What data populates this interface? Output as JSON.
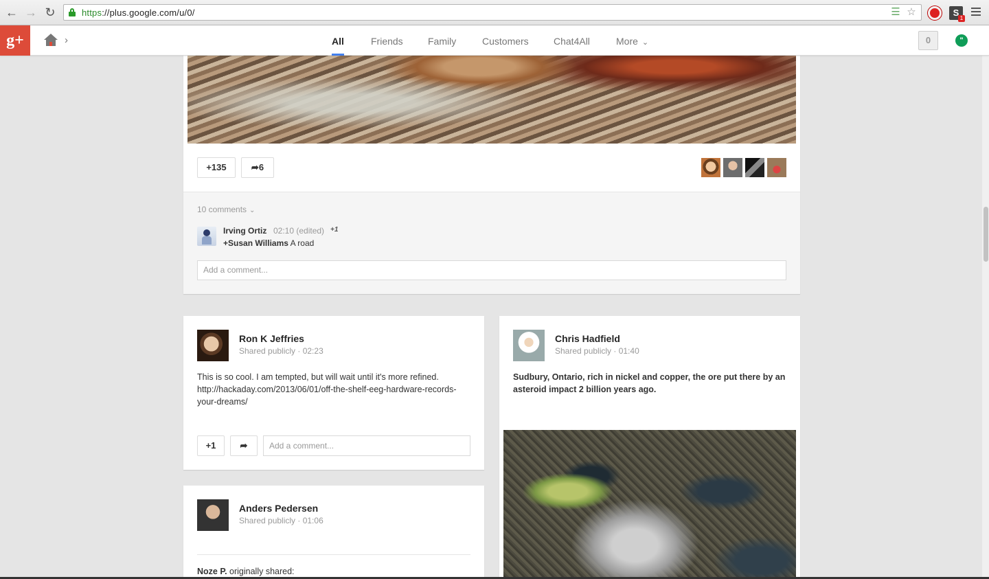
{
  "browser": {
    "url_scheme": "https",
    "url_rest": "://plus.google.com/u/0/",
    "ext_badge": "1"
  },
  "gbar": {
    "logo": "g+",
    "tabs": [
      "All",
      "Friends",
      "Family",
      "Customers",
      "Chat4All",
      "More"
    ],
    "active_tab": "All",
    "notifications_count": "0"
  },
  "big_post": {
    "plus_count": "+135",
    "share_count": "6",
    "comments_count": "10 comments",
    "comment": {
      "author": "Irving Ortiz",
      "meta": "02:10 (edited)",
      "plus": "+1",
      "mention": "+Susan Williams",
      "text": " A road"
    },
    "add_comment_placeholder": "Add a comment..."
  },
  "ron_post": {
    "author": "Ron K Jeffries",
    "meta": "Shared publicly  ·  02:23",
    "text_line1": "This is so cool. I am tempted, but will wait until it's more refined.",
    "text_line2": "http://hackaday.com/2013/06/01/off-the-shelf-eeg-hardware-records-",
    "text_line3": "your-dreams/",
    "plus_label": "+1",
    "add_comment_placeholder": "Add a comment..."
  },
  "chris_post": {
    "author": "Chris Hadfield",
    "meta": "Shared publicly  ·  01:40",
    "text_line1": "Sudbury, Ontario, rich in nickel and copper, the ore put there by an",
    "text_line2": "asteroid impact 2 billion years ago."
  },
  "anders_post": {
    "author": "Anders Pedersen",
    "meta": "Shared publicly  ·  01:06",
    "orig_author": "Noze P.",
    "orig_text": " originally shared:"
  },
  "colors": {
    "gplus_red": "#dd4b39",
    "active_tab_underline": "#427fed",
    "hangouts_green": "#0f9d58"
  }
}
